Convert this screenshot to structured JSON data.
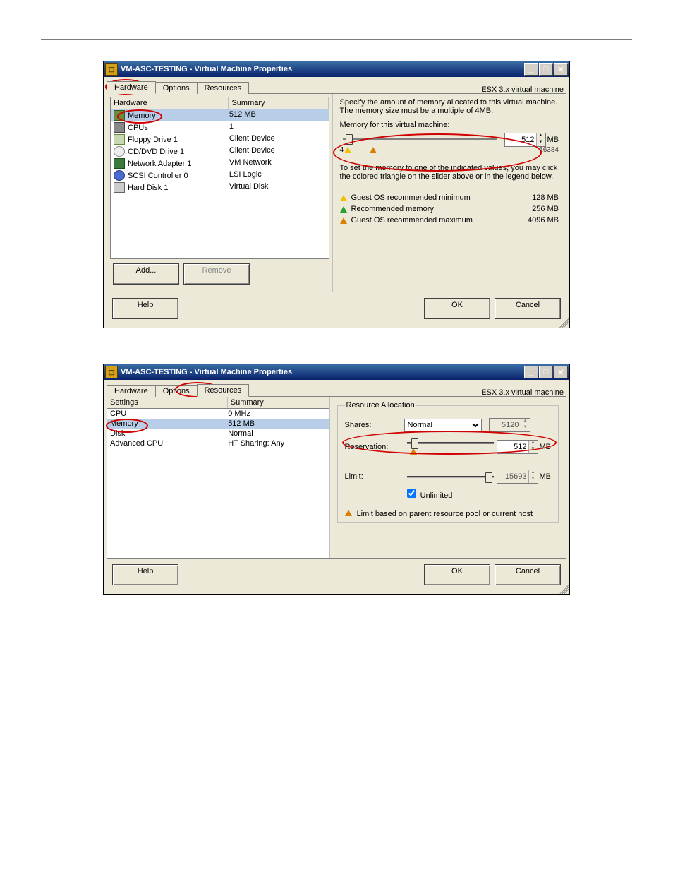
{
  "window1": {
    "title": "VM-ASC-TESTING - Virtual Machine Properties",
    "subtitle": "ESX 3.x virtual machine",
    "tabs": [
      "Hardware",
      "Options",
      "Resources"
    ],
    "active_tab": "Hardware",
    "grid_head": [
      "Hardware",
      "Summary"
    ],
    "rows": [
      {
        "label": "Memory",
        "summary": "512 MB",
        "icon": "mem",
        "selected": true
      },
      {
        "label": "CPUs",
        "summary": "1",
        "icon": "cpu"
      },
      {
        "label": "Floppy Drive 1",
        "summary": "Client Device",
        "icon": "fdd"
      },
      {
        "label": "CD/DVD Drive 1",
        "summary": "Client Device",
        "icon": "cd"
      },
      {
        "label": "Network Adapter 1",
        "summary": "VM Network",
        "icon": "net"
      },
      {
        "label": "SCSI Controller 0",
        "summary": "LSI Logic",
        "icon": "scsi"
      },
      {
        "label": "Hard Disk 1",
        "summary": "Virtual Disk",
        "icon": "hdd"
      }
    ],
    "add": "Add...",
    "remove": "Remove",
    "right": {
      "desc": "Specify the amount of memory allocated to this virtual machine. The memory size must be a multiple of 4MB.",
      "mem_label": "Memory for this virtual machine:",
      "mem_value": "512",
      "mem_unit": "MB",
      "scale_min": "4",
      "scale_max": "16384",
      "note": "To set the memory to one of the indicated values, you may click the colored triangle on the slider above or in the legend below.",
      "legend": [
        {
          "tri": "ye",
          "label": "Guest OS recommended minimum",
          "val": "128 MB"
        },
        {
          "tri": "gr",
          "label": "Recommended memory",
          "val": "256 MB"
        },
        {
          "tri": "or",
          "label": "Guest OS recommended maximum",
          "val": "4096 MB"
        }
      ]
    },
    "help": "Help",
    "ok": "OK",
    "cancel": "Cancel"
  },
  "window2": {
    "title": "VM-ASC-TESTING - Virtual Machine Properties",
    "subtitle": "ESX 3.x virtual machine",
    "tabs": [
      "Hardware",
      "Options",
      "Resources"
    ],
    "active_tab": "Resources",
    "grid_head": [
      "Settings",
      "Summary"
    ],
    "rows": [
      {
        "label": "CPU",
        "summary": "0 MHz"
      },
      {
        "label": "Memory",
        "summary": "512 MB",
        "selected": true
      },
      {
        "label": "Disk",
        "summary": "Normal"
      },
      {
        "label": "Advanced CPU",
        "summary": "HT Sharing: Any"
      }
    ],
    "right": {
      "group": "Resource Allocation",
      "shares_label": "Shares:",
      "shares_value": "Normal",
      "shares_num": "5120",
      "reservation_label": "Reservation:",
      "reservation_value": "512",
      "limit_label": "Limit:",
      "limit_value": "15693",
      "unit": "MB",
      "unlimited_label": "Unlimited",
      "unlimited_checked": true,
      "note": "Limit based on parent resource pool or current host"
    },
    "help": "Help",
    "ok": "OK",
    "cancel": "Cancel"
  }
}
